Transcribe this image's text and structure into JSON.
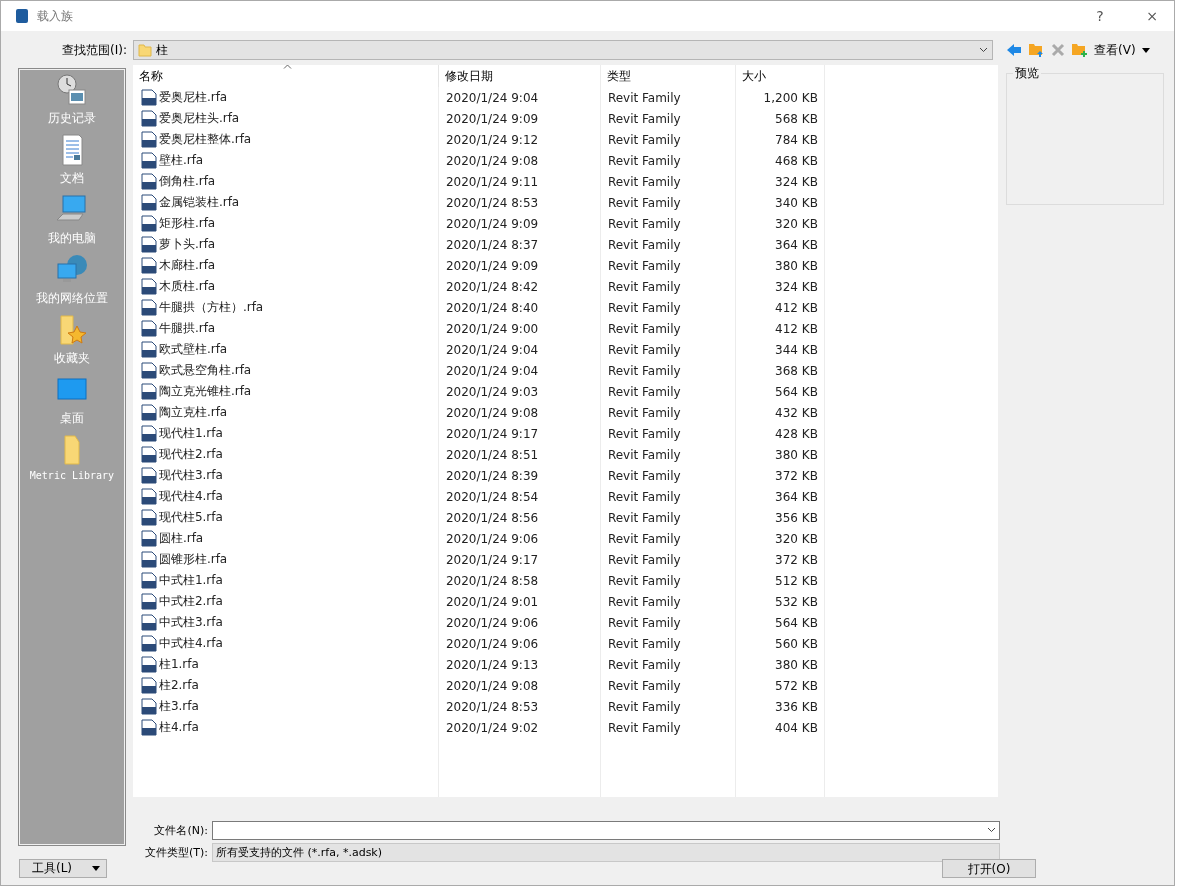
{
  "window": {
    "title": "载入族",
    "help": "?",
    "close": "×"
  },
  "lookin": {
    "label": "查找范围(I):",
    "value": "柱"
  },
  "toolbar": {
    "view": "查看(V)"
  },
  "sidebar": {
    "items": [
      {
        "label": "历史记录",
        "kind": "history"
      },
      {
        "label": "文档",
        "kind": "documents"
      },
      {
        "label": "我的电脑",
        "kind": "computer"
      },
      {
        "label": "我的网络位置",
        "kind": "network"
      },
      {
        "label": "收藏夹",
        "kind": "favorites"
      },
      {
        "label": "桌面",
        "kind": "desktop"
      },
      {
        "label": "Metric Library",
        "kind": "folder"
      }
    ]
  },
  "table": {
    "columns": [
      "名称",
      "修改日期",
      "类型",
      "大小"
    ],
    "rows": [
      [
        "爱奥尼柱.rfa",
        "2020/1/24 9:04",
        "Revit Family",
        "1,200 KB"
      ],
      [
        "爱奥尼柱头.rfa",
        "2020/1/24 9:09",
        "Revit Family",
        "568 KB"
      ],
      [
        "爱奥尼柱整体.rfa",
        "2020/1/24 9:12",
        "Revit Family",
        "784 KB"
      ],
      [
        "壁柱.rfa",
        "2020/1/24 9:08",
        "Revit Family",
        "468 KB"
      ],
      [
        "倒角柱.rfa",
        "2020/1/24 9:11",
        "Revit Family",
        "324 KB"
      ],
      [
        "金属铠装柱.rfa",
        "2020/1/24 8:53",
        "Revit Family",
        "340 KB"
      ],
      [
        "矩形柱.rfa",
        "2020/1/24 9:09",
        "Revit Family",
        "320 KB"
      ],
      [
        "萝卜头.rfa",
        "2020/1/24 8:37",
        "Revit Family",
        "364 KB"
      ],
      [
        "木廊柱.rfa",
        "2020/1/24 9:09",
        "Revit Family",
        "380 KB"
      ],
      [
        "木质柱.rfa",
        "2020/1/24 8:42",
        "Revit Family",
        "324 KB"
      ],
      [
        "牛腿拱（方柱）.rfa",
        "2020/1/24 8:40",
        "Revit Family",
        "412 KB"
      ],
      [
        "牛腿拱.rfa",
        "2020/1/24 9:00",
        "Revit Family",
        "412 KB"
      ],
      [
        "欧式壁柱.rfa",
        "2020/1/24 9:04",
        "Revit Family",
        "344 KB"
      ],
      [
        "欧式悬空角柱.rfa",
        "2020/1/24 9:04",
        "Revit Family",
        "368 KB"
      ],
      [
        "陶立克光锥柱.rfa",
        "2020/1/24 9:03",
        "Revit Family",
        "564 KB"
      ],
      [
        "陶立克柱.rfa",
        "2020/1/24 9:08",
        "Revit Family",
        "432 KB"
      ],
      [
        "现代柱1.rfa",
        "2020/1/24 9:17",
        "Revit Family",
        "428 KB"
      ],
      [
        "现代柱2.rfa",
        "2020/1/24 8:51",
        "Revit Family",
        "380 KB"
      ],
      [
        "现代柱3.rfa",
        "2020/1/24 8:39",
        "Revit Family",
        "372 KB"
      ],
      [
        "现代柱4.rfa",
        "2020/1/24 8:54",
        "Revit Family",
        "364 KB"
      ],
      [
        "现代柱5.rfa",
        "2020/1/24 8:56",
        "Revit Family",
        "356 KB"
      ],
      [
        "圆柱.rfa",
        "2020/1/24 9:06",
        "Revit Family",
        "320 KB"
      ],
      [
        "圆锥形柱.rfa",
        "2020/1/24 9:17",
        "Revit Family",
        "372 KB"
      ],
      [
        "中式柱1.rfa",
        "2020/1/24 8:58",
        "Revit Family",
        "512 KB"
      ],
      [
        "中式柱2.rfa",
        "2020/1/24 9:01",
        "Revit Family",
        "532 KB"
      ],
      [
        "中式柱3.rfa",
        "2020/1/24 9:06",
        "Revit Family",
        "564 KB"
      ],
      [
        "中式柱4.rfa",
        "2020/1/24 9:06",
        "Revit Family",
        "560 KB"
      ],
      [
        "柱1.rfa",
        "2020/1/24 9:13",
        "Revit Family",
        "380 KB"
      ],
      [
        "柱2.rfa",
        "2020/1/24 9:08",
        "Revit Family",
        "572 KB"
      ],
      [
        "柱3.rfa",
        "2020/1/24 8:53",
        "Revit Family",
        "336 KB"
      ],
      [
        "柱4.rfa",
        "2020/1/24 9:02",
        "Revit Family",
        "404 KB"
      ]
    ]
  },
  "preview": {
    "label": "预览"
  },
  "filename": {
    "label": "文件名(N):"
  },
  "filetype": {
    "label": "文件类型(T):",
    "value": "所有受支持的文件 (*.rfa, *.adsk)"
  },
  "buttons": {
    "tools": "工具(L)",
    "open": "打开(O)"
  }
}
